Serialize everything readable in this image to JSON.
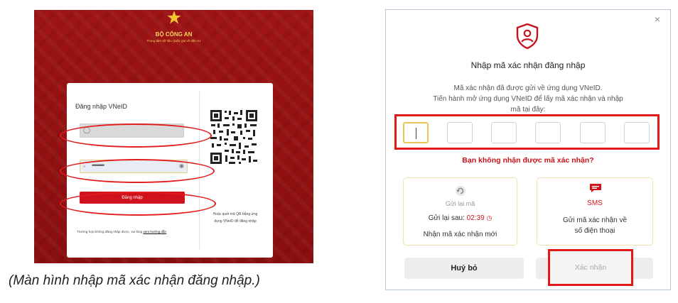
{
  "left_screen": {
    "ministry": "BỘ CÔNG AN",
    "ministry_sub": "Trung tâm dữ liệu Quốc gia về dân cư",
    "login_title": "Đăng nhập VNeID",
    "password_mask": "••••••••",
    "login_button": "Đăng nhập",
    "help_text": "Trường hợp không đăng nhập được, vui lòng",
    "help_link": "xem hướng dẫn",
    "qr_caption_1": "Hoặc quét mã QR bằng ứng",
    "qr_caption_2": "dụng VNeID để đăng nhập",
    "highlight_color": "#e21c1c"
  },
  "caption": "(Màn hình nhập mã xác nhận đăng nhập.)",
  "modal": {
    "close": "×",
    "title": "Nhập mã xác nhận đăng nhập",
    "desc_1": "Mã xác nhận đã được gửi về ứng dụng VNeID.",
    "desc_2": "Tiến hành mở ứng dụng VNeID để lấy mã xác nhận và nhập",
    "desc_3": "mã tại đây:",
    "no_code": "Bạn không nhận được mã xác nhận?",
    "resend": {
      "title": "Gửi lại mã",
      "timer_label": "Gửi lại sau:",
      "timer": "02:39",
      "desc": "Nhận mã xác nhận mới"
    },
    "sms": {
      "title": "SMS",
      "desc_1": "Gửi mã xác nhận về",
      "desc_2": "số điện thoại"
    },
    "cancel": "Huỷ bỏ",
    "confirm": "Xác nhận",
    "accent_color": "#d0121c"
  }
}
